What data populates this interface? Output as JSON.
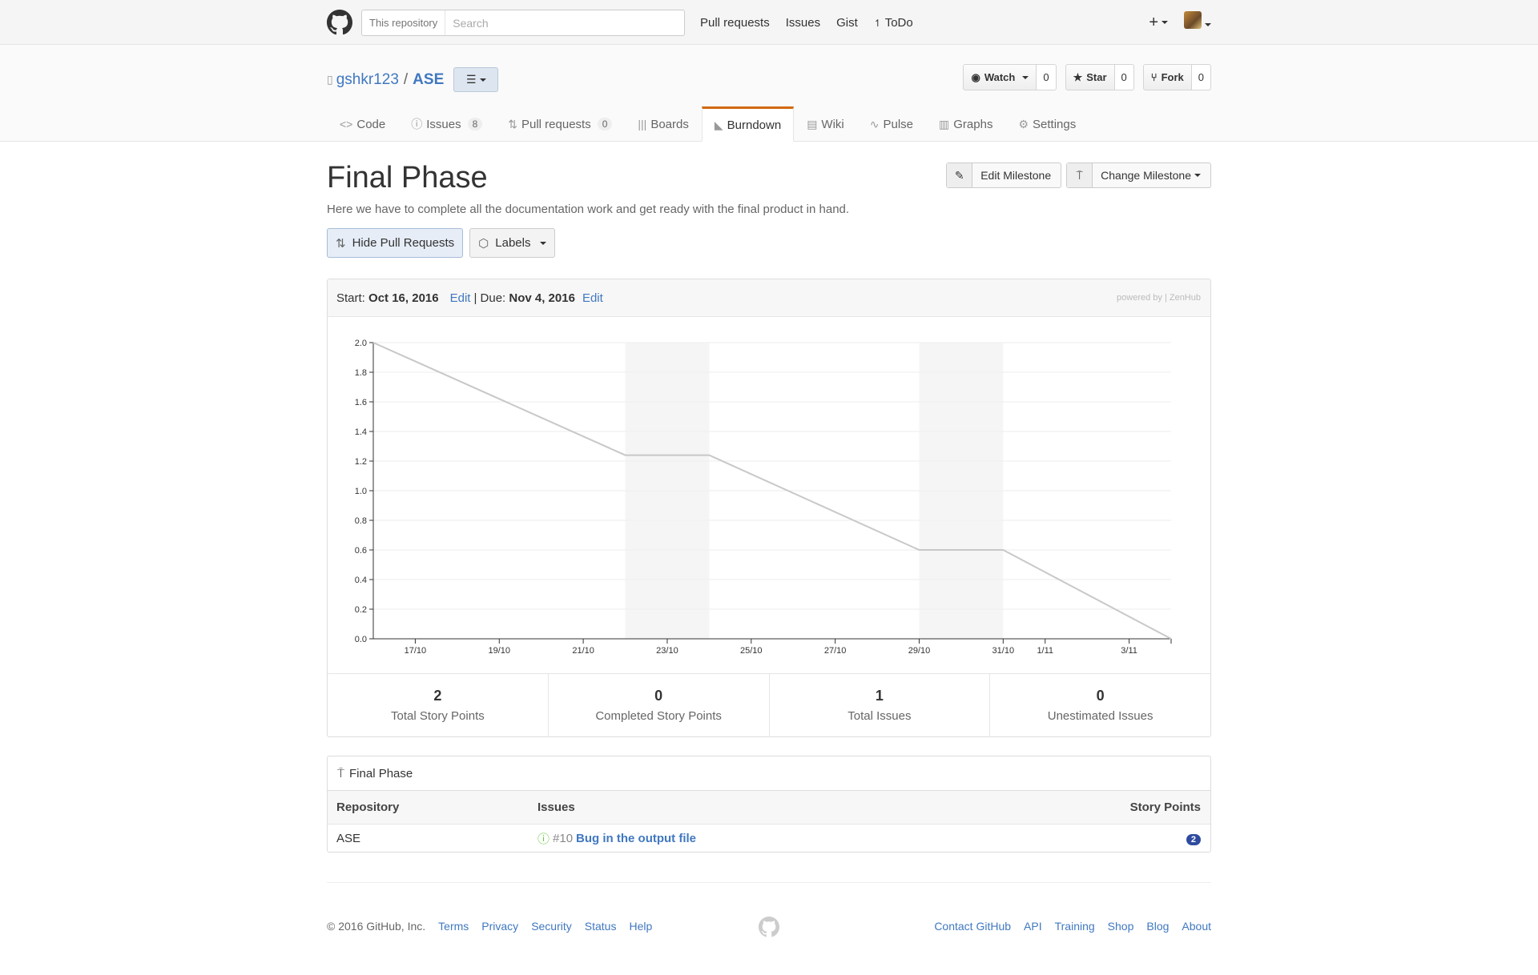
{
  "header": {
    "search_scope": "This repository",
    "search_placeholder": "Search",
    "nav": [
      "Pull requests",
      "Issues",
      "Gist",
      "ToDo"
    ],
    "new_icon": "plus-icon",
    "avatar_icon": "user-avatar"
  },
  "repo": {
    "owner": "gshkr123",
    "separator": "/",
    "name": "ASE",
    "watch": {
      "label": "Watch",
      "count": "0"
    },
    "star": {
      "label": "Star",
      "count": "0"
    },
    "fork": {
      "label": "Fork",
      "count": "0"
    },
    "tabs": [
      {
        "label": "Code",
        "icon": "code-icon"
      },
      {
        "label": "Issues",
        "count": "8",
        "icon": "issue-icon"
      },
      {
        "label": "Pull requests",
        "count": "0",
        "icon": "pr-icon"
      },
      {
        "label": "Boards",
        "icon": "boards-icon"
      },
      {
        "label": "Burndown",
        "icon": "burndown-icon"
      },
      {
        "label": "Wiki",
        "icon": "wiki-icon"
      },
      {
        "label": "Pulse",
        "icon": "pulse-icon"
      },
      {
        "label": "Graphs",
        "icon": "graph-icon"
      },
      {
        "label": "Settings",
        "icon": "gear-icon"
      }
    ]
  },
  "milestone": {
    "title": "Final Phase",
    "description": "Here we have to complete all the documentation work and get ready with the final product in hand.",
    "edit_label": "Edit Milestone",
    "change_label": "Change Milestone",
    "hide_pr_label": "Hide Pull Requests",
    "labels_label": "Labels"
  },
  "burndown": {
    "start_label": "Start:",
    "start_date": "Oct 16, 2016",
    "edit1": "Edit",
    "due_label": "| Due:",
    "due_date": "Nov 4, 2016",
    "edit2": "Edit",
    "powered": "powered by | ZenHub",
    "stats": [
      {
        "value": "2",
        "label": "Total Story Points"
      },
      {
        "value": "0",
        "label": "Completed Story Points"
      },
      {
        "value": "1",
        "label": "Total Issues"
      },
      {
        "value": "0",
        "label": "Unestimated Issues"
      }
    ]
  },
  "chart_data": {
    "type": "line",
    "x_ticks": [
      "17/10",
      "19/10",
      "21/10",
      "23/10",
      "25/10",
      "27/10",
      "29/10",
      "31/10",
      "1/11",
      "3/11"
    ],
    "x_tick_days": [
      1,
      3,
      5,
      7,
      9,
      11,
      13,
      15,
      16,
      18
    ],
    "y_ticks": [
      "0.0",
      "0.2",
      "0.4",
      "0.6",
      "0.8",
      "1.0",
      "1.2",
      "1.4",
      "1.6",
      "1.8",
      "2.0"
    ],
    "ylim": [
      0,
      2
    ],
    "xlim_days": [
      0,
      19
    ],
    "weekend_bands_days": [
      [
        6,
        8
      ],
      [
        13,
        15
      ]
    ],
    "series": [
      {
        "x_days": [
          0,
          6,
          8,
          13,
          15,
          19
        ],
        "values": [
          2.0,
          1.24,
          1.24,
          0.6,
          0.6,
          0.0
        ],
        "color": "#c8c8c8"
      }
    ],
    "grid": true
  },
  "issues_table": {
    "title": "Final Phase",
    "headers": [
      "Repository",
      "Issues",
      "Story Points"
    ],
    "rows": [
      {
        "repo": "ASE",
        "number": "#10",
        "title": "Bug in the output file",
        "points": "2"
      }
    ]
  },
  "footer": {
    "copyright": "© 2016 GitHub, Inc.",
    "left_links": [
      "Terms",
      "Privacy",
      "Security",
      "Status",
      "Help"
    ],
    "right_links": [
      "Contact GitHub",
      "API",
      "Training",
      "Shop",
      "Blog",
      "About"
    ]
  }
}
